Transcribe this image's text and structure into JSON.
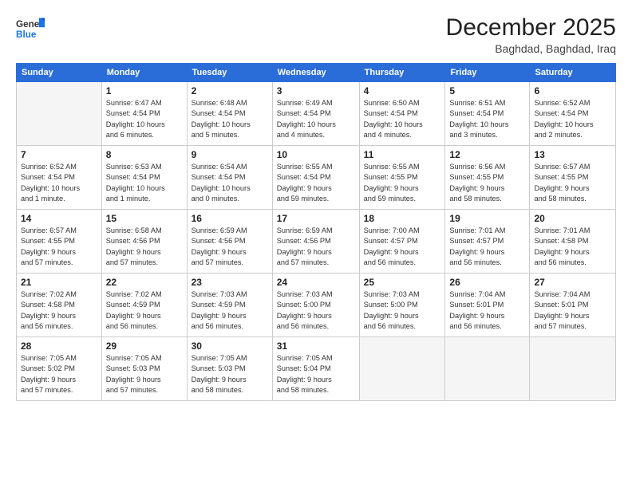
{
  "header": {
    "logo": {
      "general": "General",
      "blue": "Blue"
    },
    "title": "December 2025",
    "location": "Baghdad, Baghdad, Iraq"
  },
  "weekdays": [
    "Sunday",
    "Monday",
    "Tuesday",
    "Wednesday",
    "Thursday",
    "Friday",
    "Saturday"
  ],
  "weeks": [
    [
      {
        "day": "",
        "info": ""
      },
      {
        "day": "1",
        "info": "Sunrise: 6:47 AM\nSunset: 4:54 PM\nDaylight: 10 hours\nand 6 minutes."
      },
      {
        "day": "2",
        "info": "Sunrise: 6:48 AM\nSunset: 4:54 PM\nDaylight: 10 hours\nand 5 minutes."
      },
      {
        "day": "3",
        "info": "Sunrise: 6:49 AM\nSunset: 4:54 PM\nDaylight: 10 hours\nand 4 minutes."
      },
      {
        "day": "4",
        "info": "Sunrise: 6:50 AM\nSunset: 4:54 PM\nDaylight: 10 hours\nand 4 minutes."
      },
      {
        "day": "5",
        "info": "Sunrise: 6:51 AM\nSunset: 4:54 PM\nDaylight: 10 hours\nand 3 minutes."
      },
      {
        "day": "6",
        "info": "Sunrise: 6:52 AM\nSunset: 4:54 PM\nDaylight: 10 hours\nand 2 minutes."
      }
    ],
    [
      {
        "day": "7",
        "info": "Sunrise: 6:52 AM\nSunset: 4:54 PM\nDaylight: 10 hours\nand 1 minute."
      },
      {
        "day": "8",
        "info": "Sunrise: 6:53 AM\nSunset: 4:54 PM\nDaylight: 10 hours\nand 1 minute."
      },
      {
        "day": "9",
        "info": "Sunrise: 6:54 AM\nSunset: 4:54 PM\nDaylight: 10 hours\nand 0 minutes."
      },
      {
        "day": "10",
        "info": "Sunrise: 6:55 AM\nSunset: 4:54 PM\nDaylight: 9 hours\nand 59 minutes."
      },
      {
        "day": "11",
        "info": "Sunrise: 6:55 AM\nSunset: 4:55 PM\nDaylight: 9 hours\nand 59 minutes."
      },
      {
        "day": "12",
        "info": "Sunrise: 6:56 AM\nSunset: 4:55 PM\nDaylight: 9 hours\nand 58 minutes."
      },
      {
        "day": "13",
        "info": "Sunrise: 6:57 AM\nSunset: 4:55 PM\nDaylight: 9 hours\nand 58 minutes."
      }
    ],
    [
      {
        "day": "14",
        "info": "Sunrise: 6:57 AM\nSunset: 4:55 PM\nDaylight: 9 hours\nand 57 minutes."
      },
      {
        "day": "15",
        "info": "Sunrise: 6:58 AM\nSunset: 4:56 PM\nDaylight: 9 hours\nand 57 minutes."
      },
      {
        "day": "16",
        "info": "Sunrise: 6:59 AM\nSunset: 4:56 PM\nDaylight: 9 hours\nand 57 minutes."
      },
      {
        "day": "17",
        "info": "Sunrise: 6:59 AM\nSunset: 4:56 PM\nDaylight: 9 hours\nand 57 minutes."
      },
      {
        "day": "18",
        "info": "Sunrise: 7:00 AM\nSunset: 4:57 PM\nDaylight: 9 hours\nand 56 minutes."
      },
      {
        "day": "19",
        "info": "Sunrise: 7:01 AM\nSunset: 4:57 PM\nDaylight: 9 hours\nand 56 minutes."
      },
      {
        "day": "20",
        "info": "Sunrise: 7:01 AM\nSunset: 4:58 PM\nDaylight: 9 hours\nand 56 minutes."
      }
    ],
    [
      {
        "day": "21",
        "info": "Sunrise: 7:02 AM\nSunset: 4:58 PM\nDaylight: 9 hours\nand 56 minutes."
      },
      {
        "day": "22",
        "info": "Sunrise: 7:02 AM\nSunset: 4:59 PM\nDaylight: 9 hours\nand 56 minutes."
      },
      {
        "day": "23",
        "info": "Sunrise: 7:03 AM\nSunset: 4:59 PM\nDaylight: 9 hours\nand 56 minutes."
      },
      {
        "day": "24",
        "info": "Sunrise: 7:03 AM\nSunset: 5:00 PM\nDaylight: 9 hours\nand 56 minutes."
      },
      {
        "day": "25",
        "info": "Sunrise: 7:03 AM\nSunset: 5:00 PM\nDaylight: 9 hours\nand 56 minutes."
      },
      {
        "day": "26",
        "info": "Sunrise: 7:04 AM\nSunset: 5:01 PM\nDaylight: 9 hours\nand 56 minutes."
      },
      {
        "day": "27",
        "info": "Sunrise: 7:04 AM\nSunset: 5:01 PM\nDaylight: 9 hours\nand 57 minutes."
      }
    ],
    [
      {
        "day": "28",
        "info": "Sunrise: 7:05 AM\nSunset: 5:02 PM\nDaylight: 9 hours\nand 57 minutes."
      },
      {
        "day": "29",
        "info": "Sunrise: 7:05 AM\nSunset: 5:03 PM\nDaylight: 9 hours\nand 57 minutes."
      },
      {
        "day": "30",
        "info": "Sunrise: 7:05 AM\nSunset: 5:03 PM\nDaylight: 9 hours\nand 58 minutes."
      },
      {
        "day": "31",
        "info": "Sunrise: 7:05 AM\nSunset: 5:04 PM\nDaylight: 9 hours\nand 58 minutes."
      },
      {
        "day": "",
        "info": ""
      },
      {
        "day": "",
        "info": ""
      },
      {
        "day": "",
        "info": ""
      }
    ]
  ]
}
